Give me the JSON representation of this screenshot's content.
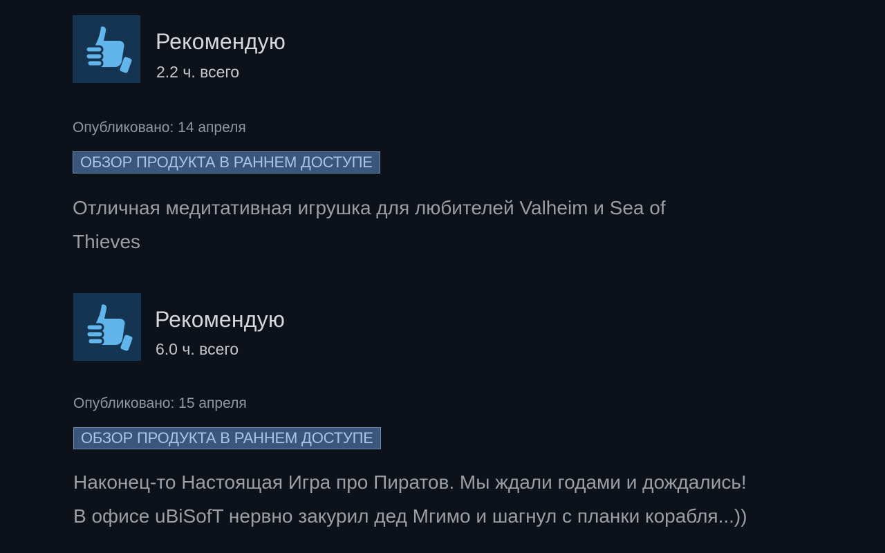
{
  "colors": {
    "background": "#0d121a",
    "thumb_bg": "#153451",
    "thumb_icon": "#62b5ea",
    "badge_bg": "#3a5679",
    "badge_border": "#6e8db4",
    "badge_text": "#a8c5e6"
  },
  "reviews": [
    {
      "icon": "thumbs-up-icon",
      "title": "Рекомендую",
      "hours": "2.2 ч. всего",
      "posted": "Опубликовано: 14 апреля",
      "badge": "ОБЗОР ПРОДУКТА В РАННЕМ ДОСТУПЕ",
      "text_lines": [
        "Отличная медитативная игрушка для любителей Valheim и Sea of",
        "Thieves"
      ]
    },
    {
      "icon": "thumbs-up-icon",
      "title": "Рекомендую",
      "hours": "6.0 ч. всего",
      "posted": "Опубликовано: 15 апреля",
      "badge": "ОБЗОР ПРОДУКТА В РАННЕМ ДОСТУПЕ",
      "text_lines": [
        "Наконец-то Настоящая Игра про Пиратов. Мы ждали годами и дождались!",
        "В офисе uBiSofT нервно закурил дед Мгимо и шагнул с планки корабля...))"
      ]
    }
  ]
}
